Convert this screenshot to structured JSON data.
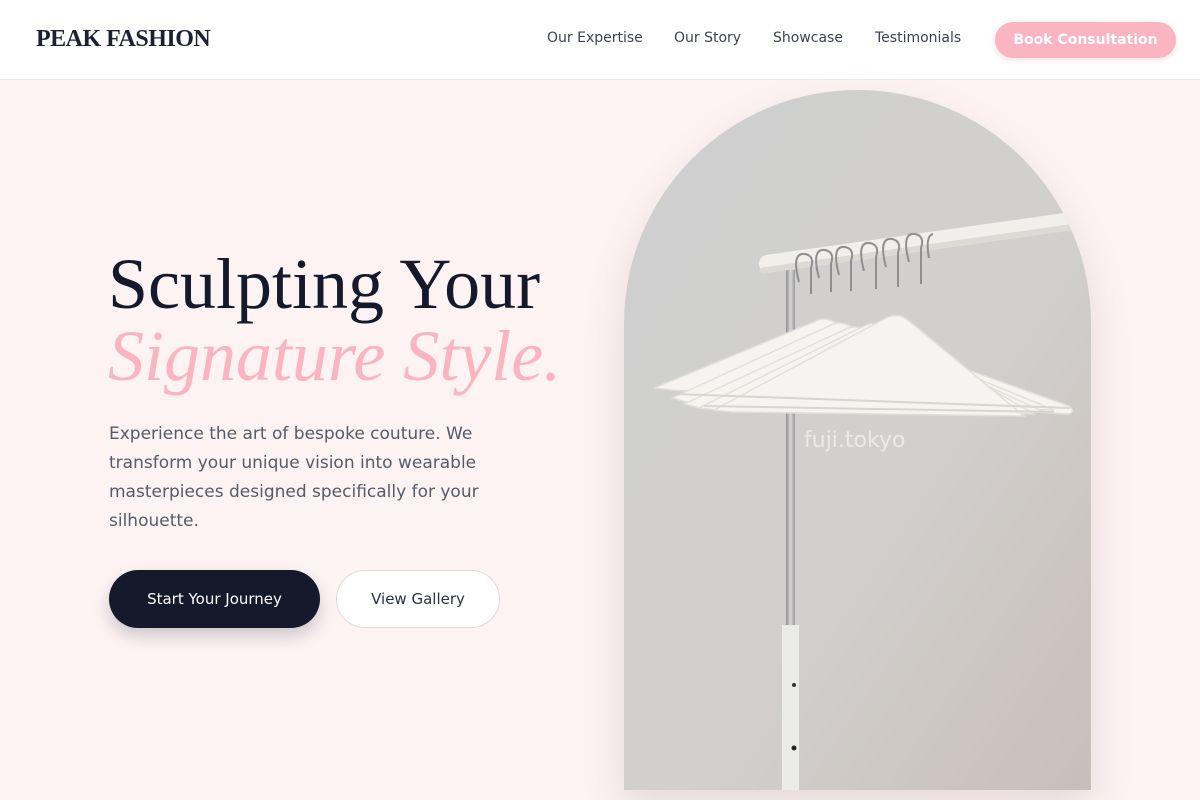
{
  "brand": {
    "name": "PEAK FASHION"
  },
  "nav": {
    "links": [
      "Our Expertise",
      "Our Story",
      "Showcase",
      "Testimonials"
    ],
    "cta_label": "Book Consultation"
  },
  "hero": {
    "title_line1": "Sculpting Your",
    "title_line2": "Signature Style.",
    "description": "Experience the art of bespoke couture. We transform your unique vision into wearable masterpieces designed specifically for your silhouette.",
    "primary_button": "Start Your Journey",
    "secondary_button": "View Gallery",
    "image_watermark": "fuji.tokyo"
  },
  "colors": {
    "accent_pink": "#fbb5c2",
    "dark_navy": "#141a2c",
    "page_background": "#fdf3f3"
  }
}
